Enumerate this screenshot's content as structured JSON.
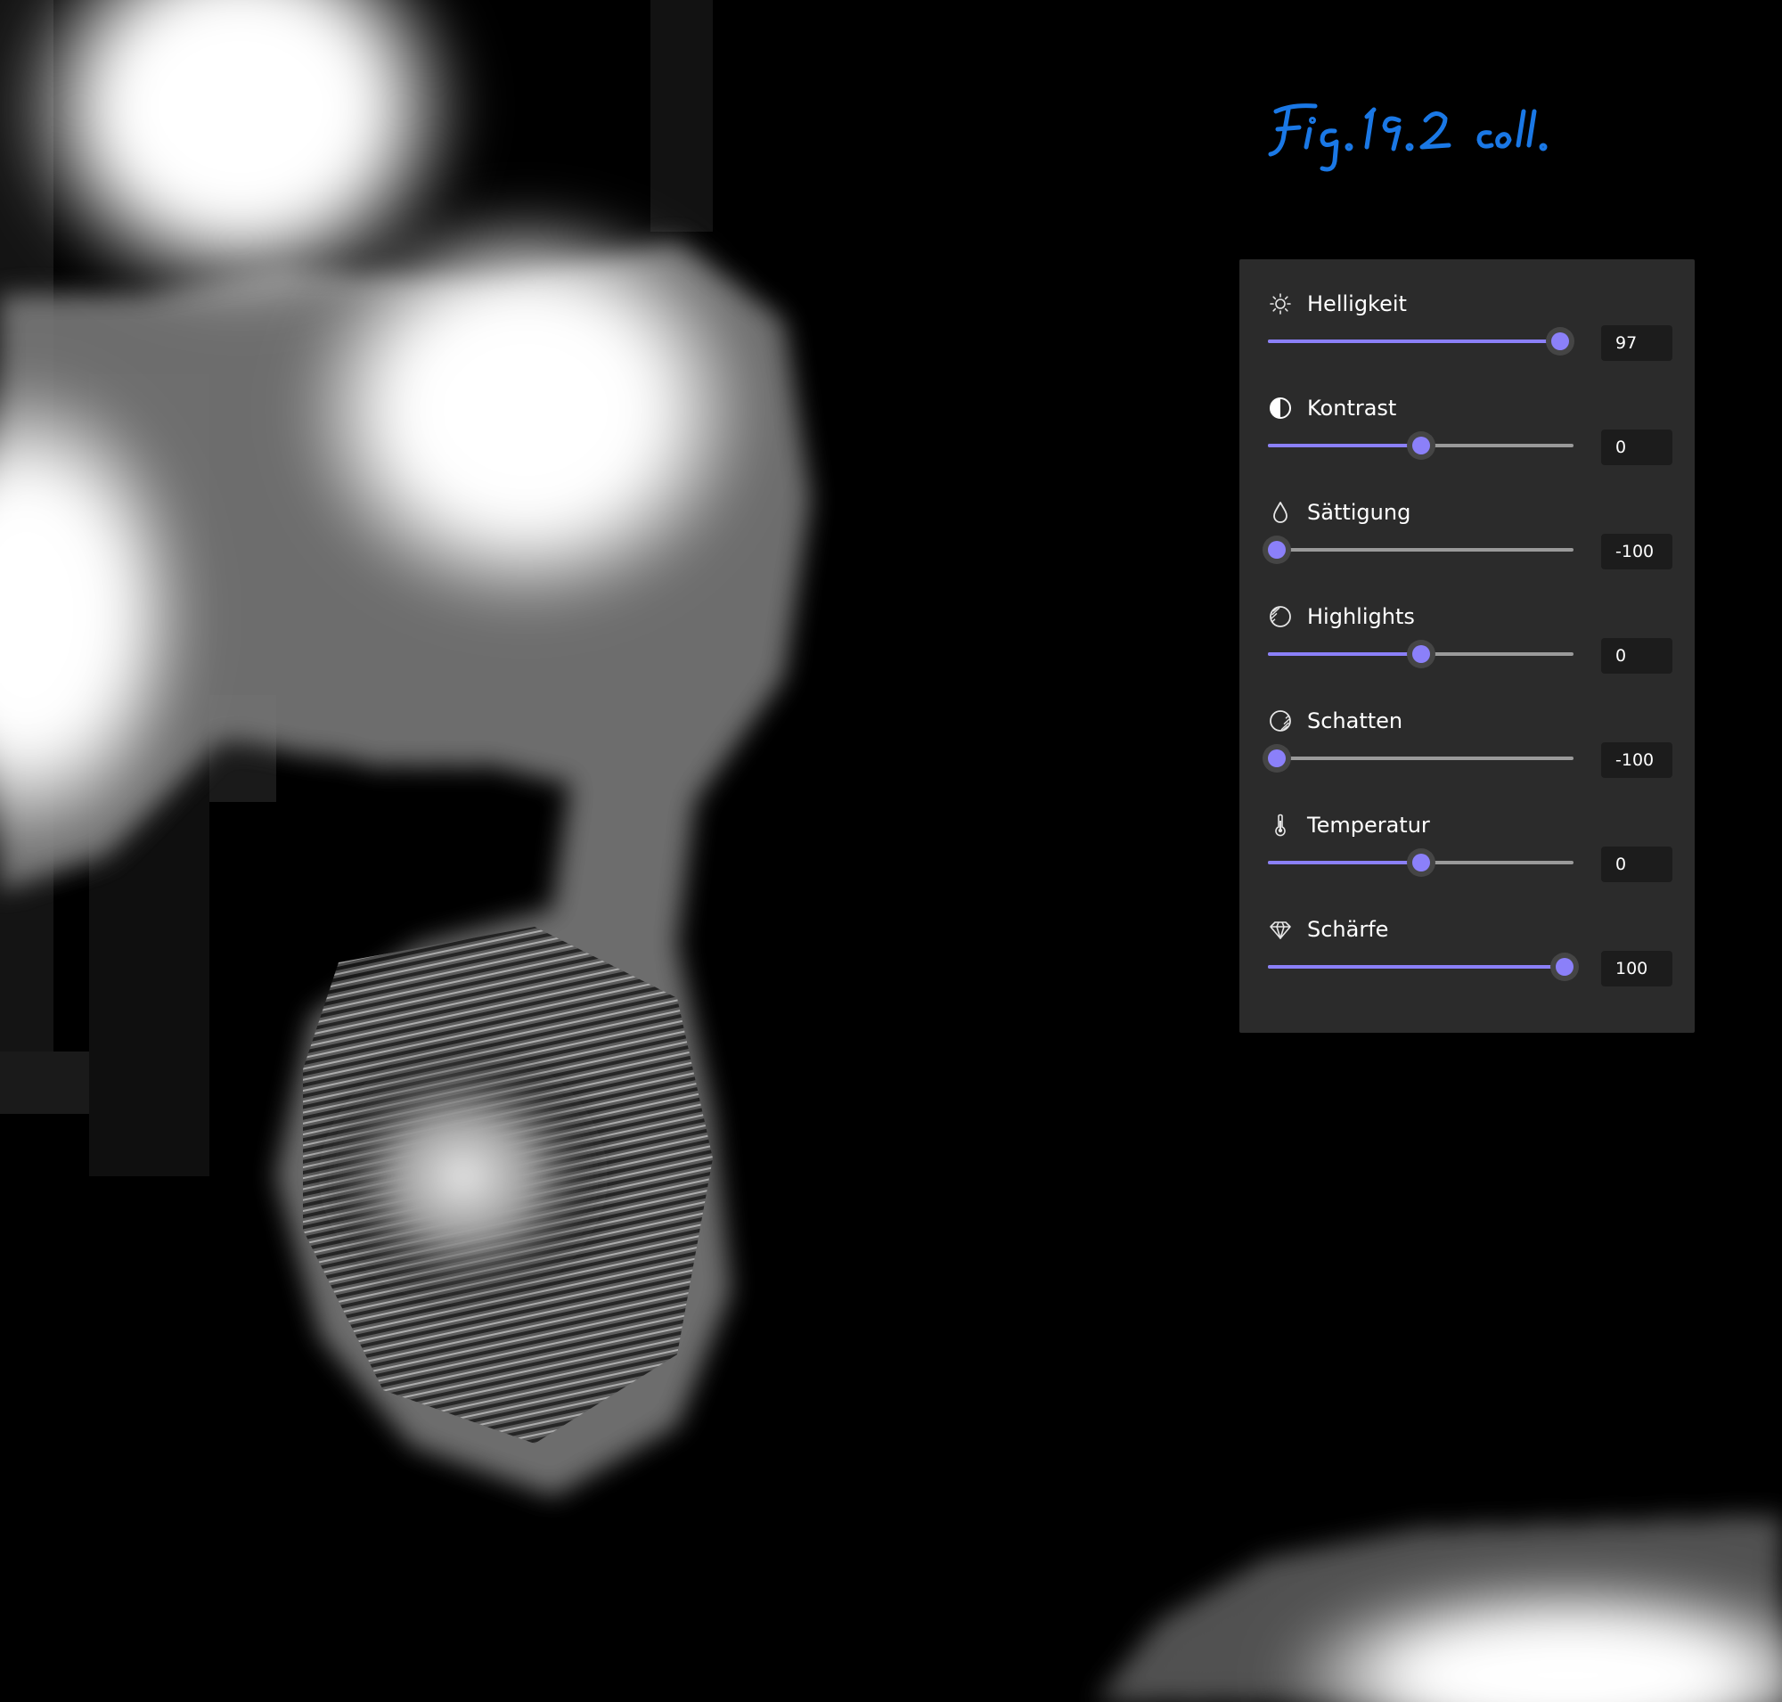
{
  "annotation": {
    "handwritten_note": "Fig. 19.2 coll."
  },
  "colors": {
    "panel_background": "#2b2b2b",
    "accent": "#8b80f9",
    "track": "#9a9a9a",
    "value_box": "#1c1c1c",
    "text": "#ffffff",
    "note_ink": "#1a78e6"
  },
  "adjustments": {
    "items": [
      {
        "label": "Helligkeit",
        "icon": "sun-icon",
        "value": "97",
        "min": -100,
        "max": 100
      },
      {
        "label": "Kontrast",
        "icon": "contrast-icon",
        "value": "0",
        "min": -100,
        "max": 100
      },
      {
        "label": "Sättigung",
        "icon": "droplet-icon",
        "value": "-100",
        "min": -100,
        "max": 100
      },
      {
        "label": "Highlights",
        "icon": "highlights-icon",
        "value": "0",
        "min": -100,
        "max": 100
      },
      {
        "label": "Schatten",
        "icon": "shadows-icon",
        "value": "-100",
        "min": -100,
        "max": 100
      },
      {
        "label": "Temperatur",
        "icon": "thermometer-icon",
        "value": "0",
        "min": -100,
        "max": 100
      },
      {
        "label": "Schärfe",
        "icon": "diamond-icon",
        "value": "100",
        "min": -100,
        "max": 100
      }
    ]
  }
}
